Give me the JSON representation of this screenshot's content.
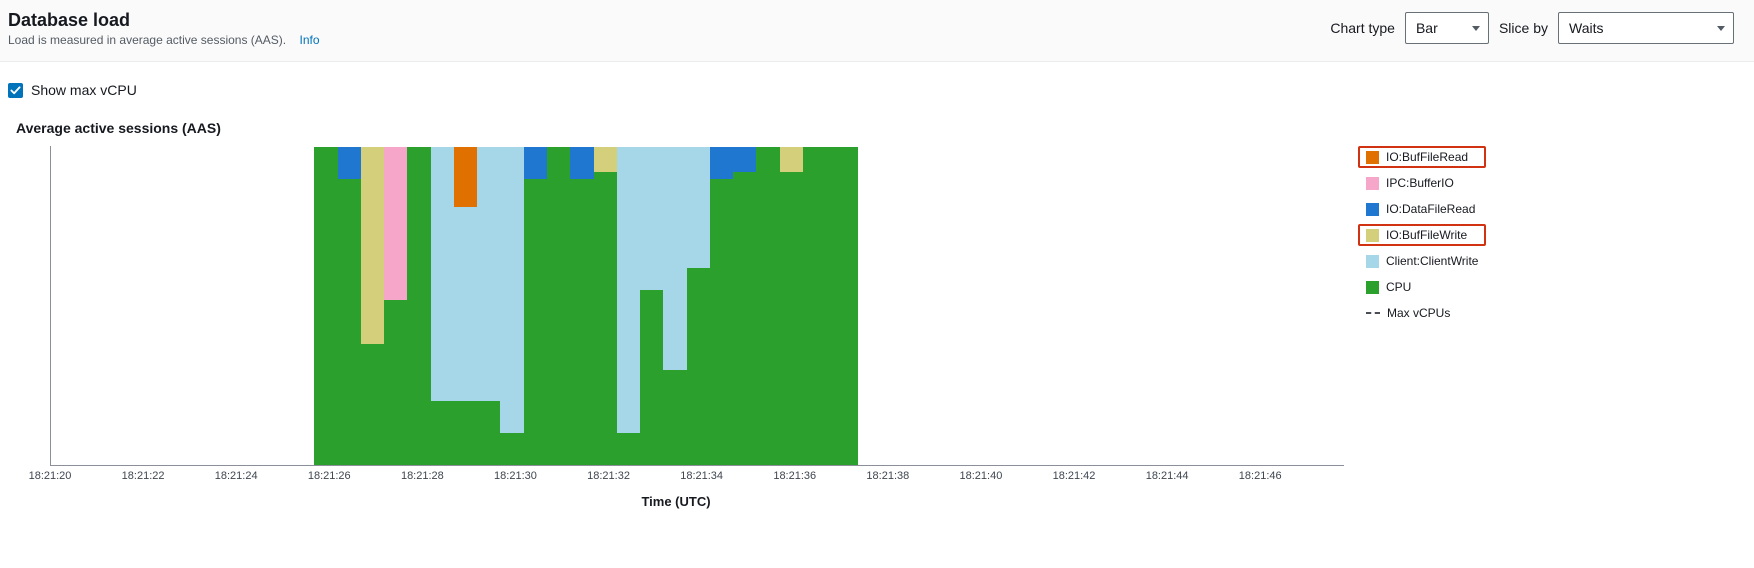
{
  "header": {
    "title": "Database load",
    "subtitle": "Load is measured in average active sessions (AAS).",
    "info": "Info",
    "chart_type_label": "Chart type",
    "chart_type_value": "Bar",
    "slice_by_label": "Slice by",
    "slice_by_value": "Waits"
  },
  "options": {
    "show_max_vcpu": "Show max vCPU",
    "show_max_vcpu_checked": true
  },
  "chart_title": "Average active sessions (AAS)",
  "xlabel": "Time (UTC)",
  "legend": [
    {
      "key": "IO:BufFileRead",
      "label": "IO:BufFileRead",
      "color": "#e07000",
      "highlight": true,
      "type": "swatch"
    },
    {
      "key": "IPC:BufferIO",
      "label": "IPC:BufferIO",
      "color": "#f6a6c9",
      "highlight": false,
      "type": "swatch"
    },
    {
      "key": "IO:DataFileRead",
      "label": "IO:DataFileRead",
      "color": "#1f77d0",
      "highlight": false,
      "type": "swatch"
    },
    {
      "key": "IO:BufFileWrite",
      "label": "IO:BufFileWrite",
      "color": "#d3cf7b",
      "highlight": true,
      "type": "swatch"
    },
    {
      "key": "Client:ClientWrite",
      "label": "Client:ClientWrite",
      "color": "#a6d7e8",
      "highlight": false,
      "type": "swatch"
    },
    {
      "key": "CPU",
      "label": "CPU",
      "color": "#2ca02c",
      "highlight": false,
      "type": "swatch"
    },
    {
      "key": "MaxvCPUs",
      "label": "Max vCPUs",
      "color": "#4a4f55",
      "highlight": false,
      "type": "dash"
    }
  ],
  "chart_data": {
    "type": "bar",
    "title": "Average active sessions (AAS)",
    "xlabel": "Time (UTC)",
    "ylabel": "",
    "ylim": [
      0,
      1.0
    ],
    "stack_order_bottom_to_top": [
      "CPU",
      "Client:ClientWrite",
      "IO:BufFileWrite",
      "IO:DataFileRead",
      "IPC:BufferIO",
      "IO:BufFileRead"
    ],
    "colors": {
      "CPU": "#2ca02c",
      "Client:ClientWrite": "#a6d7e8",
      "IO:BufFileWrite": "#d3cf7b",
      "IO:DataFileRead": "#1f77d0",
      "IPC:BufferIO": "#f6a6c9",
      "IO:BufFileRead": "#e07000"
    },
    "x_ticks": [
      "18:21:20",
      "18:21:22",
      "18:21:24",
      "18:21:26",
      "18:21:28",
      "18:21:30",
      "18:21:32",
      "18:21:34",
      "18:21:36",
      "18:21:38",
      "18:21:40",
      "18:21:42",
      "18:21:44",
      "18:21:46"
    ],
    "bars": [
      {
        "x": "18:21:26.0",
        "v": {
          "CPU": 1.0
        }
      },
      {
        "x": "18:21:26.5",
        "v": {
          "CPU": 0.9,
          "IO:DataFileRead": 0.1
        }
      },
      {
        "x": "18:21:27.0",
        "v": {
          "CPU": 0.38,
          "IO:BufFileWrite": 0.62
        }
      },
      {
        "x": "18:21:27.5",
        "v": {
          "CPU": 0.52,
          "IPC:BufferIO": 0.48
        }
      },
      {
        "x": "18:21:28.0",
        "v": {
          "CPU": 1.0
        }
      },
      {
        "x": "18:21:28.5",
        "v": {
          "CPU": 0.2,
          "Client:ClientWrite": 0.8
        }
      },
      {
        "x": "18:21:29.0",
        "v": {
          "CPU": 0.2,
          "Client:ClientWrite": 0.61,
          "IO:BufFileRead": 0.19
        }
      },
      {
        "x": "18:21:29.5",
        "v": {
          "CPU": 0.2,
          "Client:ClientWrite": 0.8
        }
      },
      {
        "x": "18:21:30.0",
        "v": {
          "CPU": 0.1,
          "Client:ClientWrite": 0.9
        }
      },
      {
        "x": "18:21:30.5",
        "v": {
          "CPU": 0.9,
          "IO:DataFileRead": 0.1
        }
      },
      {
        "x": "18:21:31.0",
        "v": {
          "CPU": 1.0
        }
      },
      {
        "x": "18:21:31.5",
        "v": {
          "CPU": 0.9,
          "IO:DataFileRead": 0.1
        }
      },
      {
        "x": "18:21:32.0",
        "v": {
          "CPU": 0.92,
          "IO:BufFileWrite": 0.08
        }
      },
      {
        "x": "18:21:32.5",
        "v": {
          "CPU": 0.1,
          "Client:ClientWrite": 0.9
        }
      },
      {
        "x": "18:21:33.0",
        "v": {
          "CPU": 0.55,
          "Client:ClientWrite": 0.45
        }
      },
      {
        "x": "18:21:33.5",
        "v": {
          "CPU": 0.3,
          "Client:ClientWrite": 0.7
        }
      },
      {
        "x": "18:21:34.0",
        "v": {
          "CPU": 0.62,
          "Client:ClientWrite": 0.38
        }
      },
      {
        "x": "18:21:34.5",
        "v": {
          "CPU": 0.9,
          "IO:DataFileRead": 0.1
        }
      },
      {
        "x": "18:21:35.0",
        "v": {
          "CPU": 0.92,
          "IO:DataFileRead": 0.08
        }
      },
      {
        "x": "18:21:35.5",
        "v": {
          "CPU": 1.0
        }
      },
      {
        "x": "18:21:36.0",
        "v": {
          "CPU": 0.92,
          "IO:BufFileWrite": 0.08
        }
      },
      {
        "x": "18:21:36.5",
        "v": {
          "CPU": 1.0
        }
      },
      {
        "x": "18:21:37.0",
        "v": {
          "CPU": 1.0
        }
      }
    ]
  }
}
